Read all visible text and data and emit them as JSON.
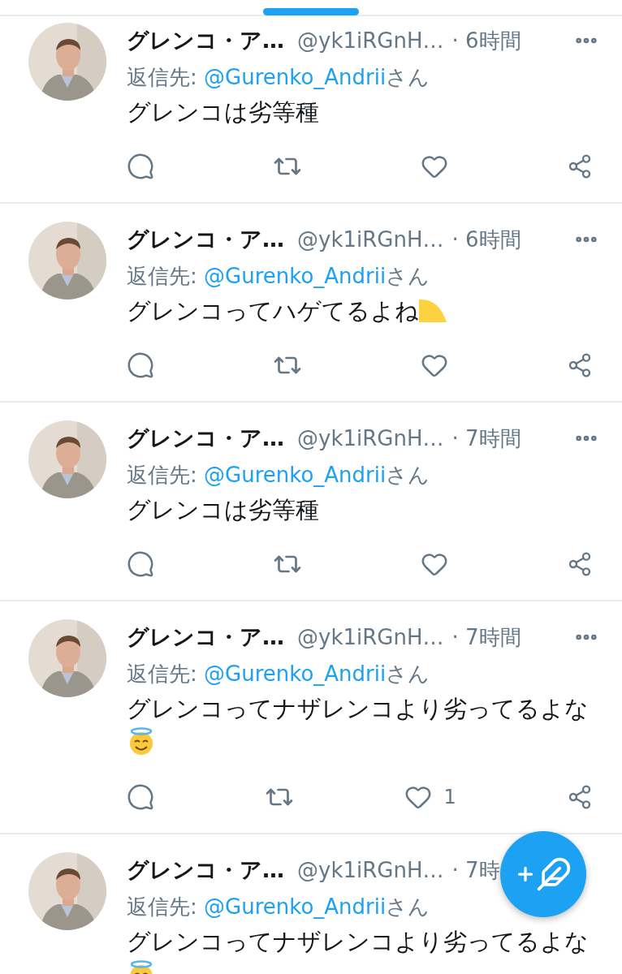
{
  "tweets": [
    {
      "name": "グレンコ・ア…",
      "handle": "@yk1iRGnH…",
      "time": "· 6時間",
      "more": true,
      "reply_label": "返信先:",
      "reply_to": "@Gurenko_Andrii",
      "reply_suffix": "さん",
      "text": "グレンコは劣等種"
    },
    {
      "name": "グレンコ・ア…",
      "handle": "@yk1iRGnH…",
      "time": "· 6時間",
      "more": true,
      "reply_label": "返信先:",
      "reply_to": "@Gurenko_Andrii",
      "reply_suffix": "さん",
      "text": "グレンコってハゲてるよね",
      "emoji": {
        "kind": "crescent"
      }
    },
    {
      "name": "グレンコ・ア…",
      "handle": "@yk1iRGnH…",
      "time": "· 7時間",
      "more": true,
      "reply_label": "返信先:",
      "reply_to": "@Gurenko_Andrii",
      "reply_suffix": "さん",
      "text": "グレンコは劣等種"
    },
    {
      "name": "グレンコ・ア…",
      "handle": "@yk1iRGnH…",
      "time": "· 7時間",
      "more": true,
      "reply_label": "返信先:",
      "reply_to": "@Gurenko_Andrii",
      "reply_suffix": "さん",
      "text": "グレンコってナザレンコより劣ってるよな",
      "emoji": {
        "kind": "halo"
      },
      "like_count": "1"
    },
    {
      "name": "グレンコ・ア…",
      "handle": "@yk1iRGnH…",
      "time": "· 7時",
      "more": false,
      "reply_label": "返信先:",
      "reply_to": "@Gurenko_Andrii",
      "reply_suffix": "さん",
      "text": "グレンコってナザレンコより劣ってるよな",
      "emoji": {
        "kind": "halo"
      }
    }
  ]
}
